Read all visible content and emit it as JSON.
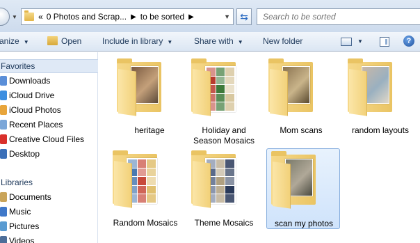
{
  "address": {
    "crumbs": [
      "0 Photos and Scrap...",
      "to be sorted"
    ],
    "overflow_marker": "«"
  },
  "search": {
    "placeholder": "Search to be sorted"
  },
  "toolbar": {
    "organize_label": "anize",
    "open_label": "Open",
    "include_label": "Include in library",
    "share_label": "Share with",
    "new_folder_label": "New folder",
    "help_glyph": "?"
  },
  "nav": {
    "favorites_header": "Favorites",
    "favorites": [
      {
        "label": "Downloads",
        "icon": "downloads-icon",
        "color": "#5a8ed8"
      },
      {
        "label": "iCloud Drive",
        "icon": "icloud-icon",
        "color": "#3c8ee0"
      },
      {
        "label": "iCloud Photos",
        "icon": "icloud-photos-icon",
        "color": "#e8a53b"
      },
      {
        "label": "Recent Places",
        "icon": "recent-places-icon",
        "color": "#7aa6d8"
      },
      {
        "label": "Creative Cloud Files",
        "icon": "creative-cloud-icon",
        "color": "#d9302b"
      },
      {
        "label": "Desktop",
        "icon": "desktop-icon",
        "color": "#3a6fb8"
      }
    ],
    "libraries_header": "Libraries",
    "libraries": [
      {
        "label": "Documents",
        "icon": "documents-icon",
        "color": "#c9a45a"
      },
      {
        "label": "Music",
        "icon": "music-icon",
        "color": "#3f78c9"
      },
      {
        "label": "Pictures",
        "icon": "pictures-icon",
        "color": "#5a9bd1"
      },
      {
        "label": "Videos",
        "icon": "videos-icon",
        "color": "#4d6e99"
      }
    ]
  },
  "folders": [
    {
      "label": "heritage",
      "selected": false,
      "colors": [
        "#7a5a40",
        "#c4a07a",
        "#5c4a3a"
      ]
    },
    {
      "label": "Holiday and Season Mosaics",
      "selected": false,
      "colors": [
        "#b83a2e",
        "#3d7a3a",
        "#d8c8a0"
      ]
    },
    {
      "label": "Mom scans",
      "selected": false,
      "colors": [
        "#8a7350",
        "#c9b48a",
        "#5a4a30"
      ]
    },
    {
      "label": "random layouts",
      "selected": false,
      "colors": [
        "#c8b8a8",
        "#9ab0c0",
        "#e0d8c8"
      ]
    },
    {
      "label": "Random Mosaics",
      "selected": false,
      "colors": [
        "#4a7ab0",
        "#c84a3a",
        "#e0c070"
      ]
    },
    {
      "label": "Theme Mosaics",
      "selected": false,
      "colors": [
        "#5a6a8a",
        "#b0a080",
        "#2a3a5a"
      ]
    },
    {
      "label": "scan my photos",
      "selected": true,
      "colors": [
        "#7a7a6a",
        "#b0a898",
        "#4a4a40"
      ]
    }
  ]
}
